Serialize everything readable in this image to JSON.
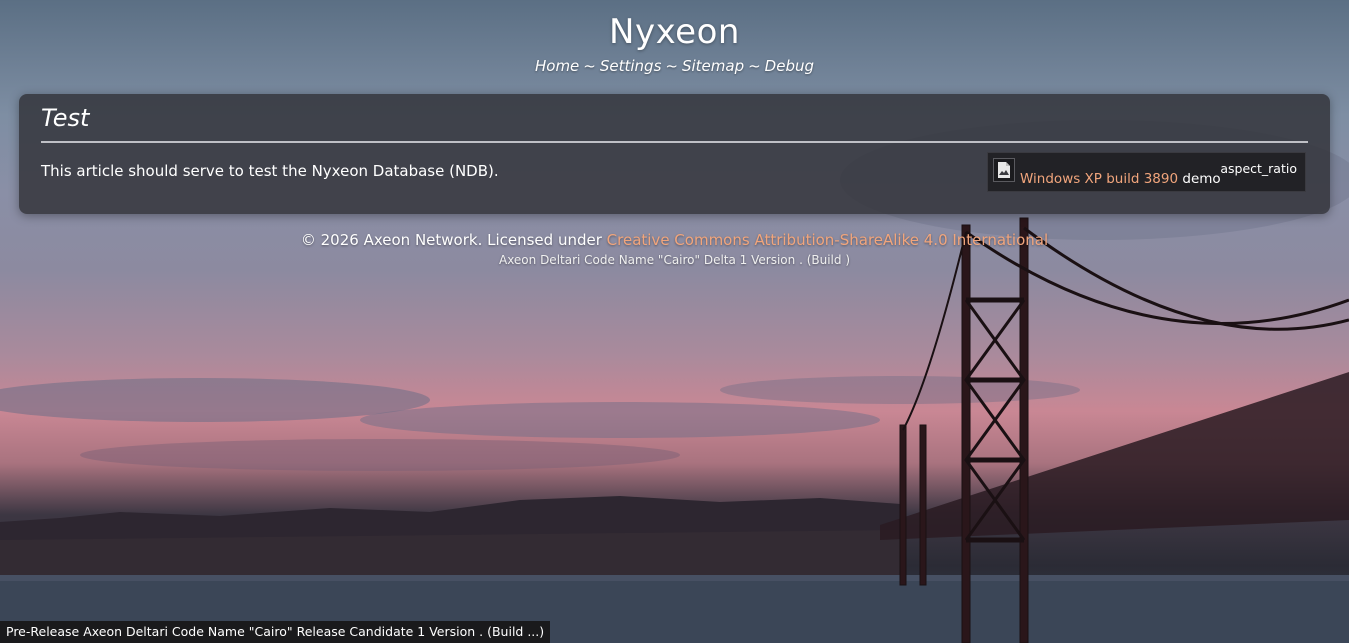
{
  "site": {
    "title": "Nyxeon",
    "nav": [
      {
        "label": "Home"
      },
      {
        "label": "Settings"
      },
      {
        "label": "Sitemap"
      },
      {
        "label": "Debug"
      }
    ],
    "nav_separator": "~"
  },
  "article": {
    "title": "Test",
    "body": "This article should serve to test the Nyxeon Database (NDB).",
    "media": {
      "icon": "broken-image-icon",
      "link_text": "Windows XP build 3890",
      "caption_suffix": " demo",
      "aspect_label": "aspect_ratio"
    }
  },
  "footer": {
    "license_prefix": "© 2026 Axeon Network. Licensed under ",
    "license_link": "Creative Commons Attribution-ShareAlike 4.0 International",
    "build_info": "Axeon Deltari Code Name \"Cairo\" Delta 1 Version . (Build )"
  },
  "status_bar": {
    "text": "Pre-Release Axeon Deltari Code Name \"Cairo\" Release Candidate 1 Version . (Build ...)"
  },
  "colors": {
    "link": "#f1a57c",
    "card_bg": "rgba(45,45,50,0.78)",
    "status_bg": "#1a1a1c"
  }
}
